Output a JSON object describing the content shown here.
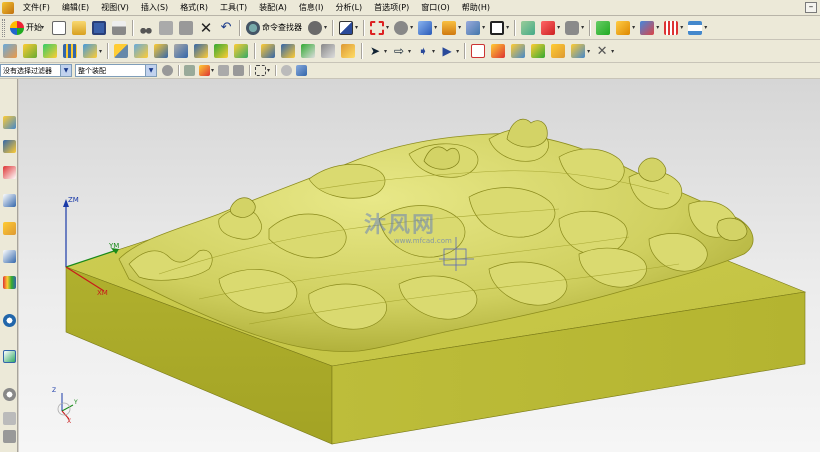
{
  "menu": {
    "items": [
      "文件(F)",
      "编辑(E)",
      "视图(V)",
      "插入(S)",
      "格式(R)",
      "工具(T)",
      "装配(A)",
      "信息(I)",
      "分析(L)",
      "首选项(P)",
      "窗口(O)",
      "帮助(H)"
    ],
    "restore_glyph": "–"
  },
  "toolbar": {
    "start_label": "开始",
    "command_finder_label": "命令查找器"
  },
  "selection_bar": {
    "filter_value": "没有选择过滤器",
    "scope_value": "整个装配"
  },
  "viewport": {
    "axis_labels": {
      "zm": "ZM",
      "ym": "YM",
      "xm": "XM"
    },
    "triad_labels": {
      "z": "Z",
      "y": "Y",
      "x": "X"
    },
    "watermark": "沐风网",
    "watermark_url": "www.mfcad.com",
    "colors": {
      "background_top": "#d6d6d6",
      "background_bottom": "#f6f6f6",
      "block_top": "#c9c94a",
      "block_front": "#a8a828",
      "block_side": "#b9b936",
      "relief": "#d7d76a",
      "relief_shadow": "#8e8e1e"
    }
  },
  "icons": {
    "toolbar_row1": [
      "start-icon",
      "new-icon",
      "open-icon",
      "save-icon",
      "print-icon",
      "cut-icon",
      "copy-icon",
      "paste-icon",
      "delete-icon",
      "undo-icon",
      "command-finder-icon",
      "show-hide-icon",
      "selection-icon",
      "fit-icon",
      "rotate-icon",
      "shaded-icon",
      "cube-icon",
      "wcs-icon",
      "plane-icon",
      "sketch-icon",
      "render-icon",
      "camera-icon",
      "mold-icon",
      "ruler-icon"
    ],
    "toolbar_row2": [
      "edit-feature-icon",
      "sketch-tool-icon",
      "table-icon",
      "layer-icon",
      "dimension-icon",
      "curve-icon",
      "extrude-icon",
      "trim-icon",
      "offset-icon",
      "pattern-icon",
      "mirror-icon",
      "section-icon",
      "analysis-icon",
      "measure-icon",
      "move-icon",
      "close-x-icon"
    ],
    "left_bar": [
      "assembly-navigator-icon",
      "constraint-navigator-icon",
      "part-navigator-icon",
      "reuse-library-icon",
      "hd3d-icon",
      "web-browser-icon",
      "history-icon",
      "system-materials-icon",
      "process-studio-icon",
      "roles-icon",
      "info-icon",
      "palette-icon",
      "sidebar-scroll-icon"
    ]
  }
}
